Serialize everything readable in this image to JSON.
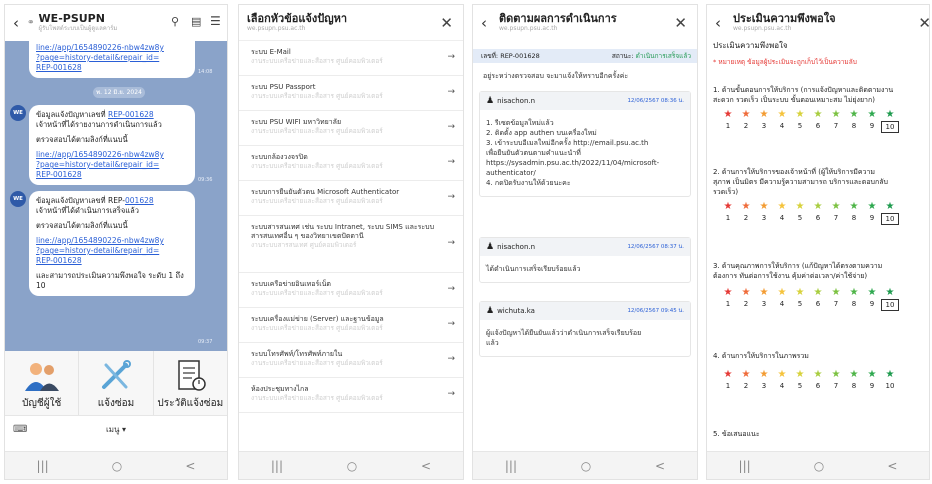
{
  "nav": {
    "recent": "|||",
    "home": "○",
    "back": "<"
  },
  "p1": {
    "title": "WE-PSUPN",
    "subtitle": "ผู้รับโพสต์ระบบเป็นผู้ดูแลคาร์ม",
    "msg0": {
      "link_a": "line://app/1654890226-nbw4zw8y",
      "link_b": "?page=history-detail&repair_id=",
      "link_c": "REP-001628",
      "time": "14:08"
    },
    "date_pill": "พ. 12 มิ.ย. 2024",
    "avatar": "WE",
    "msg1": {
      "line1a": "ข้อมูลแจ้งปัญหาเลขที่ ",
      "line1b": "REP-",
      "line2": "001628",
      "line3": " เจ้าหน้าที่ได้รายงานการดำเนินการแล้ว",
      "line4": "ตรวจสอบได้ตามลิงก์ที่แนบนี้",
      "link_a": "line://app/1654890226-nbw4zw8y",
      "link_b": "?page=history-detail&repair_id=",
      "link_c": "REP-001628",
      "time": "09:36"
    },
    "msg2": {
      "line1a": "ข้อมูลแจ้งปัญหาเลขที่ REP-",
      "line1b": "001628",
      "line2": "เจ้าหน้าที่ได้ดำเนินการเสร็จแล้ว",
      "line3": "ตรวจสอบได้ตามลิงก์ที่แนบนี้",
      "link_a": "line://app/1654890226-nbw4zw8y",
      "link_b": "?page=history-detail&repair_id=",
      "link_c": "REP-001628",
      "line4": "และสามารถประเมินความพึงพอใจ ระดับ 1 ถึง 10",
      "time": "09:37"
    },
    "menu": [
      {
        "label": "บัญชีผู้ใช้"
      },
      {
        "label": "แจ้งซ่อม"
      },
      {
        "label": "ประวัติแจ้งซ่อม"
      }
    ],
    "keyboard_menu": "เมนู ▾"
  },
  "p2": {
    "title": "เลือกหัวข้อแจ้งปัญหา",
    "subtitle": "we.psupn.psu.ac.th",
    "desc": "งานระบบเครือข่ายและสื่อสาร ศูนย์คอมพิวเตอร์",
    "items": [
      "ระบบ E-Mail",
      "ระบบ PSU Passport",
      "ระบบ PSU WIFI มหาวิทยาลัย",
      "ระบบกล้องวงจรปิด",
      "ระบบการยืนยันตัวตน Microsoft Authenticator",
      "ระบบสารสนเทศ เช่น ระบบ Intranet, ระบบ SIMS และระบบสารสนเทศอื่น ๆ ของวิทยาเขตปัตตานี",
      "ระบบเครือข่ายอินเทอร์เน็ต",
      "ระบบเครื่องแม่ข่าย (Server) และฐานข้อมูล",
      "ระบบโทรศัพท์/โทรศัพท์ภายใน",
      "ห้องประชุมทางไกล"
    ],
    "desc_long": "งานระบบสารสนเทศ ศูนย์คอมพิวเตอร์"
  },
  "p3": {
    "title": "ติดตามผลการดำเนินการ",
    "subtitle": "we.psupn.psu.ac.th",
    "ref_label": "เลขที่: REP-001628",
    "status_label": "สถานะ:",
    "status_value": "ดำเนินการเสร็จแล้ว",
    "note": "อยู่ระหว่างตรวจสอบ จะมาแจ้งให้ทราบอีกครั้งค่ะ",
    "cards": [
      {
        "user": "nisachon.n",
        "date": "12/06/2567 08:36 น.",
        "body": [
          "1. รีเซตข้อมูลใหม่แล้ว",
          "2. ติดตั้ง app authen บนเครื่องใหม่",
          "3. เข้าระบบอีเมลใหม่อีกครั้ง http://email.psu.ac.th",
          "เพื่อยืนยันตัวตนตามคำแนะนำที่",
          "https://sysadmin.psu.ac.th/2022/11/04/microsoft-",
          "authenticator/",
          "4. กดปิดรับงานให้ด้วยนะคะ"
        ]
      },
      {
        "user": "nisachon.n",
        "date": "12/06/2567 08:37 น.",
        "body": [
          "ได้ดำเนินการเสร็จเรียบร้อยแล้ว"
        ]
      },
      {
        "user": "wichuta.ka",
        "date": "12/06/2567 09:45 น.",
        "body": [
          "ผู้แจ้งปัญหาได้ยืนยันแล้วว่าดำเนินการเสร็จเรียบร้อย",
          "แล้ว"
        ]
      }
    ]
  },
  "p4": {
    "title": "ประเมินความพึงพอใจ",
    "subtitle": "we.psupn.psu.ac.th",
    "heading": "ประเมินความพึงพอใจ",
    "remark": "* หมายเหตุ ข้อมูลผู้ประเมินจะถูกเก็บไว้เป็นความลับ",
    "questions": [
      {
        "text1": "1. ด้านขั้นตอนการให้บริการ (การแจ้งปัญหาและติดตามงาน",
        "text2": "สะดวก รวดเร็ว เป็นระบบ ขั้นตอนเหมาะสม ไม่ยุ่งยาก)",
        "selected": "10"
      },
      {
        "text1": "2. ด้านการให้บริการของเจ้าหน้าที่ (ผู้ให้บริการมีความ",
        "text2": "สุภาพ เป็นมิตร มีความรู้ความสามารถ บริการและตอบกลับ",
        "text3": "รวดเร็ว)",
        "selected": "10"
      },
      {
        "text1": "3. ด้านคุณภาพการให้บริการ (แก้ปัญหาได้ตรงตามความ",
        "text2": "ต้องการ ทันต่อการใช้งาน คุ้มค่าต่อเวลา/ค่าใช้จ่าย)",
        "selected": "10"
      },
      {
        "text1": "4. ด้านการให้บริการในภาพรวม",
        "selected": ""
      }
    ],
    "star_glyph": "★",
    "star_colors": [
      "#e53935",
      "#ef6c3a",
      "#f39c33",
      "#f5c33b",
      "#d7d23b",
      "#a8cd3f",
      "#7cc242",
      "#4fb548",
      "#2ea84f",
      "#1d9a4d"
    ],
    "scale": [
      "1",
      "2",
      "3",
      "4",
      "5",
      "6",
      "7",
      "8",
      "9",
      "10"
    ],
    "suggest": "5. ข้อเสนอแนะ"
  }
}
